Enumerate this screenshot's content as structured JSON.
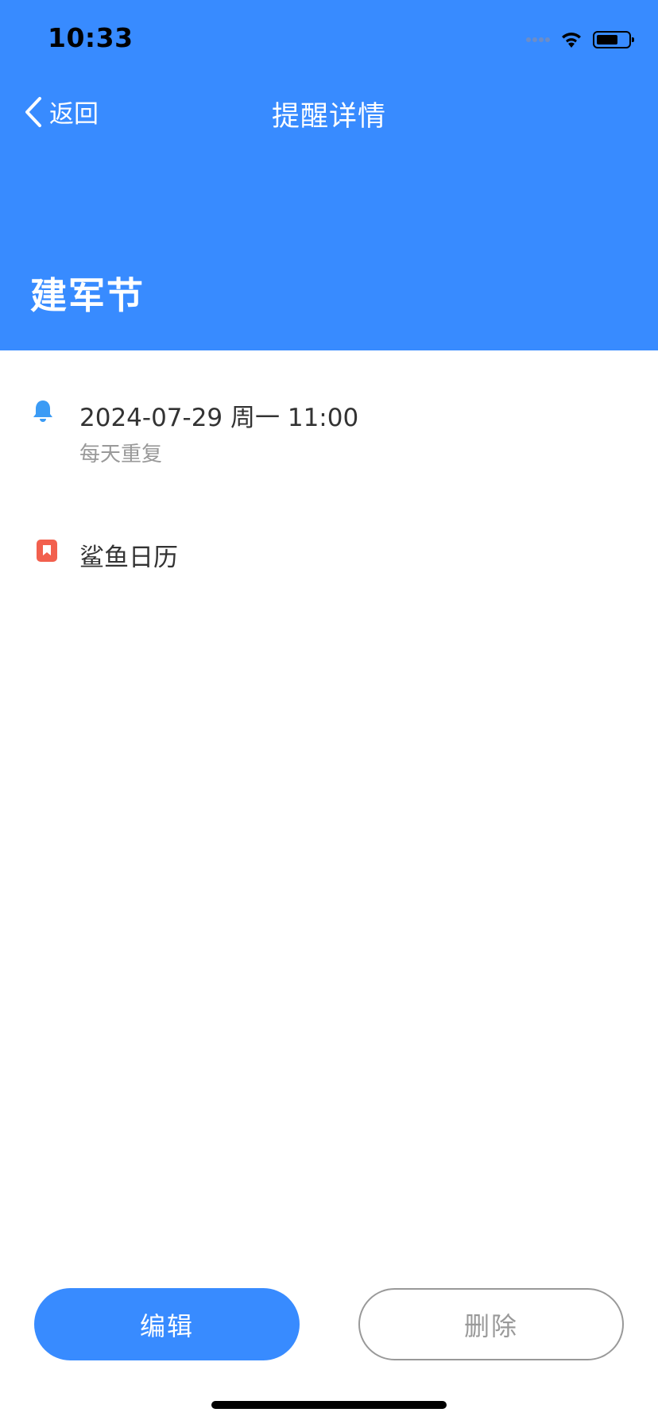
{
  "status_bar": {
    "time": "10:33"
  },
  "nav": {
    "back_label": "返回",
    "title": "提醒详情"
  },
  "event": {
    "title": "建军节",
    "datetime": "2024-07-29 周一 11:00",
    "repeat": "每天重复",
    "calendar": "鲨鱼日历"
  },
  "actions": {
    "edit_label": "编辑",
    "delete_label": "删除"
  },
  "colors": {
    "primary": "#388bff",
    "bell_icon": "#3b9bf5",
    "calendar_icon": "#f2604e",
    "text_primary": "#333333",
    "text_secondary": "#999999"
  },
  "icons": {
    "back": "chevron-left-icon",
    "reminder": "bell-icon",
    "calendar": "bookmark-icon"
  }
}
